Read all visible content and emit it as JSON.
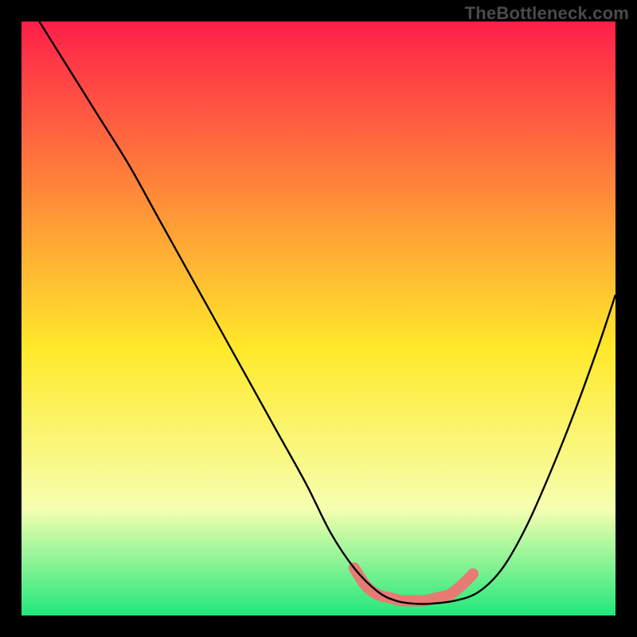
{
  "watermark": "TheBottleneck.com",
  "colors": {
    "black": "#000000",
    "line": "#000000",
    "salmon": "#e77a73",
    "gradient_top": "#ff1f4a",
    "gradient_mid": "#ffe92a",
    "gradient_bottom": "#20e87a"
  },
  "chart_data": {
    "type": "line",
    "title": "",
    "xlabel": "",
    "ylabel": "",
    "xlim": [
      0,
      100
    ],
    "ylim": [
      0,
      100
    ],
    "grid": false,
    "series": [
      {
        "name": "curve",
        "x": [
          3,
          8,
          13,
          18,
          23,
          28,
          33,
          38,
          43,
          48,
          52,
          56,
          60,
          63,
          66,
          69,
          73,
          77,
          81,
          85,
          89,
          93,
          97,
          100
        ],
        "y": [
          100,
          92,
          84,
          76,
          67,
          58,
          49,
          40,
          31,
          22,
          14,
          8,
          4,
          2.5,
          2,
          2,
          2.5,
          4,
          8,
          15,
          24,
          34,
          45,
          54
        ]
      },
      {
        "name": "highlight_band",
        "x": [
          56,
          58,
          60,
          62,
          64,
          66,
          68,
          70,
          72,
          74,
          76
        ],
        "y": [
          8,
          5,
          3.5,
          3,
          2.5,
          2.5,
          2.5,
          3,
          3.5,
          5,
          7
        ]
      }
    ]
  }
}
